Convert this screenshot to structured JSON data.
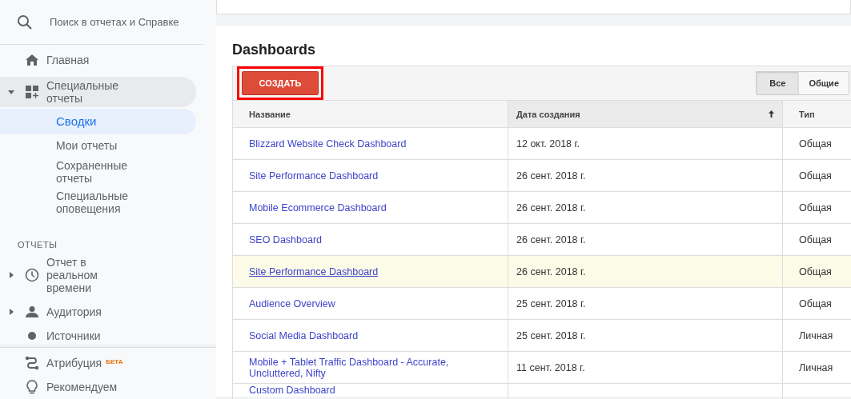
{
  "search": {
    "placeholder": "Поиск в отчетах и Справке"
  },
  "sidebar": {
    "nav": [
      {
        "label": "Главная"
      },
      {
        "label": "Специальные отчеты",
        "expanded": true,
        "children": [
          {
            "label": "Сводки",
            "selected": true
          },
          {
            "label": "Мои отчеты",
            "selected": false
          },
          {
            "label": "Сохраненные отчеты",
            "selected": false
          },
          {
            "label": "Специальные оповещения",
            "selected": false
          }
        ]
      }
    ],
    "section_title": "ОТЧЕТЫ",
    "reports": [
      {
        "label": "Отчет в реальном времени",
        "expanded": false
      },
      {
        "label": "Аудитория",
        "expanded": false
      },
      {
        "label": "Источники"
      }
    ],
    "bottom": [
      {
        "label": "Атрибуция",
        "badge": "БЕТА"
      },
      {
        "label": "Рекомендуем"
      }
    ]
  },
  "dashboards": {
    "title": "Dashboards",
    "create_button": {
      "label": "СОЗДАТЬ",
      "highlighted": true
    },
    "filters": [
      {
        "label": "Все",
        "selected": true
      },
      {
        "label": "Общие",
        "selected": false
      }
    ],
    "columns": [
      {
        "label": "Название",
        "sorted": false
      },
      {
        "label": "Дата создания",
        "sorted": true
      },
      {
        "label": "Тип",
        "sorted": false
      }
    ],
    "rows": [
      {
        "name": "Blizzard Website Check Dashboard",
        "date": "12 окт. 2018 г.",
        "type": "Общая",
        "hovered": false
      },
      {
        "name": "Site Performance Dashboard",
        "date": "26 сент. 2018 г.",
        "type": "Общая",
        "hovered": false
      },
      {
        "name": "Mobile Ecommerce Dashboard",
        "date": "26 сент. 2018 г.",
        "type": "Общая",
        "hovered": false
      },
      {
        "name": "SEO Dashboard",
        "date": "26 сент. 2018 г.",
        "type": "Общая",
        "hovered": false
      },
      {
        "name": "Site Performance Dashboard",
        "date": "26 сент. 2018 г.",
        "type": "Общая",
        "hovered": true
      },
      {
        "name": "Audience Overview",
        "date": "25 сент. 2018 г.",
        "type": "Общая",
        "hovered": false
      },
      {
        "name": "Social Media Dashboard",
        "date": "25 сент. 2018 г.",
        "type": "Личная",
        "hovered": false
      },
      {
        "name": "Mobile + Tablet Traffic Dashboard - Accurate, Uncluttered, Nifty",
        "date": "11 сент. 2018 г.",
        "type": "Личная",
        "hovered": false
      },
      {
        "name": "Custom Dashboard",
        "hovered": false
      }
    ]
  }
}
